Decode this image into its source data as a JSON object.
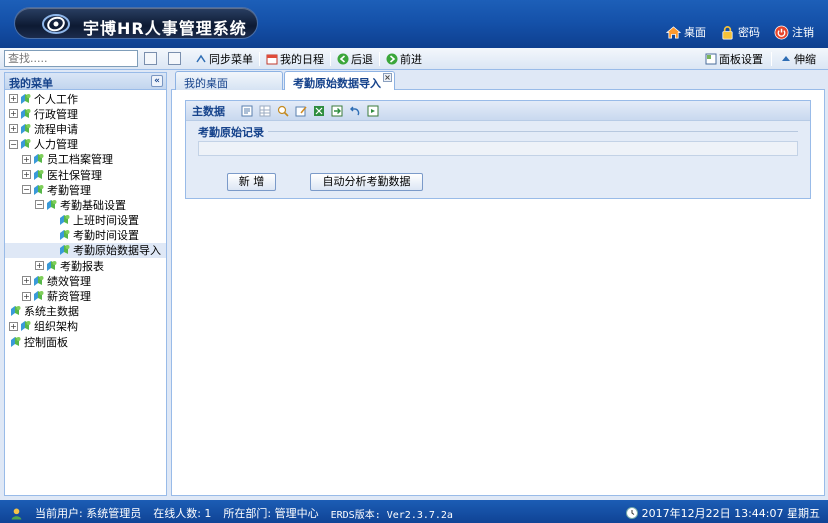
{
  "header": {
    "app_title": "宇博HR人事管理系统",
    "links": [
      {
        "label": "桌面",
        "icon": "home-icon"
      },
      {
        "label": "密码",
        "icon": "lock-icon"
      },
      {
        "label": "注销",
        "icon": "power-icon"
      }
    ]
  },
  "toolbar": {
    "search_placeholder": "查找.....",
    "sync_menu": "同步菜单",
    "my_schedule": "我的日程",
    "back": "后退",
    "forward": "前进",
    "panel_settings": "面板设置",
    "collapse": "伸缩"
  },
  "sidebar": {
    "title": "我的菜单",
    "items": [
      {
        "label": "个人工作",
        "level": 0,
        "toggle": "+"
      },
      {
        "label": "行政管理",
        "level": 0,
        "toggle": "+"
      },
      {
        "label": "流程申请",
        "level": 0,
        "toggle": "+"
      },
      {
        "label": "人力管理",
        "level": 0,
        "toggle": "-"
      },
      {
        "label": "员工档案管理",
        "level": 1,
        "toggle": "+"
      },
      {
        "label": "医社保管理",
        "level": 1,
        "toggle": "+"
      },
      {
        "label": "考勤管理",
        "level": 1,
        "toggle": "-"
      },
      {
        "label": "考勤基础设置",
        "level": 2,
        "toggle": "-"
      },
      {
        "label": "上班时间设置",
        "level": 3,
        "toggle": ""
      },
      {
        "label": "考勤时间设置",
        "level": 3,
        "toggle": ""
      },
      {
        "label": "考勤原始数据导入",
        "level": 3,
        "toggle": "",
        "selected": true
      },
      {
        "label": "考勤报表",
        "level": 2,
        "toggle": "+"
      },
      {
        "label": "绩效管理",
        "level": 1,
        "toggle": "+"
      },
      {
        "label": "薪资管理",
        "level": 1,
        "toggle": "+"
      },
      {
        "label": "系统主数据",
        "level": 0,
        "toggle": ""
      },
      {
        "label": "组织架构",
        "level": 0,
        "toggle": "+"
      },
      {
        "label": "控制面板",
        "level": 0,
        "toggle": ""
      }
    ]
  },
  "tabs": [
    {
      "label": "我的桌面",
      "active": false
    },
    {
      "label": "考勤原始数据导入",
      "active": true
    }
  ],
  "panel": {
    "title": "主数据",
    "fieldset_legend": "考勤原始记录",
    "buttons": {
      "new": "新 增",
      "auto_analyze": "自动分析考勤数据"
    }
  },
  "status": {
    "current_user": "当前用户: 系统管理员",
    "online": "在线人数: 1",
    "department": "所在部门: 管理中心",
    "version": "ERDS版本: Ver2.3.7.2a",
    "datetime": "2017年12月22日 13:44:07 星期五"
  }
}
